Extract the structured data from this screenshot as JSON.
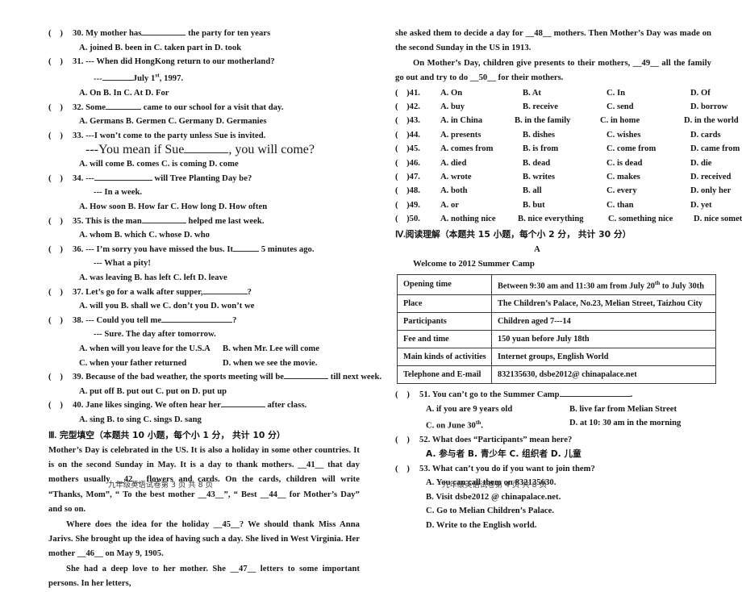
{
  "left_page": {
    "footer": "九年级英语试卷第 3 页  共 8 页",
    "questions": [
      {
        "num": "30.",
        "stem_a": "My mother has",
        "stem_b": "the party for ten years",
        "options": "A. joined    B. been in    C. taken part in    D. took"
      },
      {
        "num": "31.",
        "stem_a": "--- When did HongKong return to our motherland?",
        "sub_a": "---",
        "sub_b": "July 1st, 1997.",
        "options": "A. On      B. In      C. At      D. For"
      },
      {
        "num": "32.",
        "stem_a": "Some",
        "stem_b": "came to our school for a visit that day.",
        "options": "A. Germans       B. Germen       C. Germany       D. Germanies"
      },
      {
        "num": "33.",
        "stem_a": "---I won’t come to the party unless Sue is invited.",
        "sub_a": "---You mean if Sue",
        "sub_b": ", you will come?",
        "options": "A. will come      B. comes      C. is coming      D. come"
      },
      {
        "num": "34.",
        "stem_a": "---",
        "stem_b": "will Tree Planting Day be?",
        "sub_a": "--- In a week.",
        "options": "A. How soon      B. How far      C. How long      D. How often"
      },
      {
        "num": "35.",
        "stem_a": "This is the man",
        "stem_b": "helped me last week.",
        "options": "A. whom      B. which      C. whose      D. who"
      },
      {
        "num": "36.",
        "stem_a": "--- I’m sorry you have missed the bus. It",
        "stem_b": "5 minutes ago.",
        "sub_a": "--- What a pity!",
        "options": "A. was leaving      B. has left      C. left      D. leave"
      },
      {
        "num": "37.",
        "stem_a": "Let’s go for a walk after supper,",
        "stem_b": "?",
        "options": "A. will you      B. shall we      C. don’t you      D. won’t we"
      },
      {
        "num": "38.",
        "stem_a": "--- Could you tell me",
        "stem_b": "?",
        "sub_a": "--- Sure. The day after tomorrow.",
        "options_1a": "A. when will you leave for the U.S.A",
        "options_1b": "B. when Mr. Lee will come",
        "options_2a": "C. when your father returned",
        "options_2b": "D. when we see the movie."
      },
      {
        "num": "39.",
        "stem_a": "Because of the bad weather, the sports meeting will be",
        "stem_b": "till next week.",
        "options": "A. put off       B. put out       C. put on       D. put up"
      },
      {
        "num": "40.",
        "stem_a": "Jane likes singing. We often hear her",
        "stem_b": "after class.",
        "options": "A. sing       B. to sing       C. sings       D. sang"
      }
    ],
    "section3": {
      "roman": "Ⅲ.",
      "heading": " 完型填空（本题共 10 小题，每个小 1 分， 共计 10 分）",
      "para1": "Mother’s Day is celebrated in the US. It is also a holiday in some other countries. It is on the second Sunday in May. It is a day to thank mothers. __41__ that day mothers usually __42__ flowers and cards. On the cards, children will write “Thanks, Mom”, “ To the best mother __43__”, “ Best __44__ for Mother’s Day” and so on.",
      "para2": "Where does the idea for the holiday __45__? We should thank Miss Anna Jarivs. She brought up the idea of having such a day. She lived in West Virginia. Her mother __46__ on May 9, 1905.",
      "para3": "She had a deep love to her mother. She __47__ letters to some important persons. In her letters,"
    }
  },
  "right_page": {
    "footer": "九年级英语试卷第 4 页  共 8 页",
    "cloze_tail": {
      "para1": "she asked them to decide a day for __48__ mothers. Then Mother’s Day was made on the second Sunday in the US in 1913.",
      "para2": "On Mother’s Day, children give presents to their mothers, __49__ all the family go out and try to do __50__ for their mothers."
    },
    "cloze_options": [
      {
        "num": "41.",
        "a": "A. On",
        "b": "B. At",
        "c": "C. In",
        "d": "D. Of"
      },
      {
        "num": "42.",
        "a": "A. buy",
        "b": "B. receive",
        "c": "C. send",
        "d": "D. borrow"
      },
      {
        "num": "43.",
        "a": "A. in China",
        "b": "B. in the family",
        "c": "C. in home",
        "d": "D. in the world"
      },
      {
        "num": "44.",
        "a": "A. presents",
        "b": "B. dishes",
        "c": "C. wishes",
        "d": "D. cards"
      },
      {
        "num": "45.",
        "a": "A. comes from",
        "b": "B. is from",
        "c": "C. come from",
        "d": "D. came from"
      },
      {
        "num": "46.",
        "a": "A. died",
        "b": "B. dead",
        "c": "C. is dead",
        "d": "D. die"
      },
      {
        "num": "47.",
        "a": "A. wrote",
        "b": "B. writes",
        "c": "C. makes",
        "d": "D. received"
      },
      {
        "num": "48.",
        "a": "A. both",
        "b": "B. all",
        "c": "C. every",
        "d": "D. only her"
      },
      {
        "num": "49.",
        "a": "A. or",
        "b": "B. but",
        "c": "C. than",
        "d": "D. yet"
      },
      {
        "num": "50.",
        "a": "A. nothing nice",
        "b": "B. nice everything",
        "c": "C. something nice",
        "d": "D. nice something"
      }
    ],
    "section4": {
      "roman": "Ⅳ.",
      "heading": "阅读理解（本题共 15 小题，每个小 2 分， 共计 30 分）",
      "passage_label": "A",
      "camp_title": "Welcome to 2012 Summer Camp"
    },
    "camp_table": {
      "rows": [
        {
          "key": "Opening time",
          "valueA": "Between 9:30 am and 11:30 am from July 20",
          "sup": "th",
          "valueB": " to July 30th"
        },
        {
          "key": "Place",
          "value": "The Children’s Palace, No.23, Melian Street, Taizhou City"
        },
        {
          "key": "Participants",
          "value": "Children aged 7---14"
        },
        {
          "key": "Fee and time",
          "value": "150 yuan before July 18th"
        },
        {
          "key": "Main kinds of activities",
          "value": "Internet groups, English World"
        },
        {
          "key": "Telephone and E-mail",
          "value": "832135630, dsbe2012@ chinapalace.net"
        }
      ]
    },
    "reading_questions": {
      "q51": {
        "num": "51.",
        "stem_a": "You can’t go to the Summer Camp",
        "stem_b": ".",
        "a": "A. if you are 9 years old",
        "b": "B. live far from Melian Street",
        "c": "C. on June 30",
        "c_sup": "th",
        "c_tail": ".",
        "d": "D. at 10: 30 am in the morning"
      },
      "q52": {
        "num": "52.",
        "stem": "What does “Participants” mean here?",
        "options": "A. 参与者        B. 青少年      C. 组织者       D. 儿童"
      },
      "q53": {
        "num": "53.",
        "stem": "What can’t you do if you want to join them?",
        "a": "A. You can call them on 832135630.",
        "b": "B. Visit dsbe2012 @ chinapalace.net.",
        "c": "C. Go to Melian Children’s Palace.",
        "d": "D. Write to the English world."
      }
    }
  }
}
